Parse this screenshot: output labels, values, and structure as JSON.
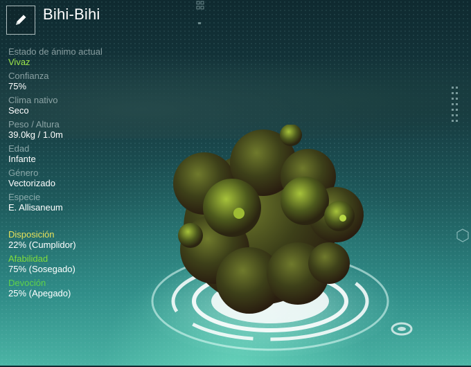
{
  "header": {
    "title": "Bihi-Bihi",
    "edit_icon": "pencil-icon"
  },
  "stats": [
    {
      "label": "Estado de ánimo actual",
      "value": "Vivaz",
      "highlight": true
    },
    {
      "label": "Confianza",
      "value": "75%"
    },
    {
      "label": "Clima nativo",
      "value": "Seco"
    },
    {
      "label": "Peso / Altura",
      "value": "39.0kg / 1.0m"
    },
    {
      "label": "Edad",
      "value": "Infante"
    },
    {
      "label": "Género",
      "value": "Vectorizado"
    },
    {
      "label": "Especie",
      "value": "E. Allisaneum"
    }
  ],
  "traits": [
    {
      "label": "Disposición",
      "value": "22% (Cumplidor)",
      "color": "#e8e25a"
    },
    {
      "label": "Afabilidad",
      "value": "75% (Sosegado)",
      "color": "#7fdc3c"
    },
    {
      "label": "Devoción",
      "value": "25% (Apegado)",
      "color": "#5fd14a"
    }
  ],
  "colors": {
    "mood_value": "#9fe84a"
  }
}
